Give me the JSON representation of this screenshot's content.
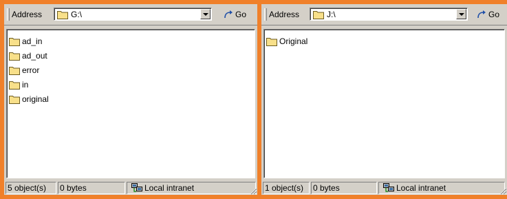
{
  "left_pane": {
    "address_label": "Address",
    "address_value": "G:\\",
    "go_label": "Go",
    "items": [
      "ad_in",
      "ad_out",
      "error",
      "in",
      "original"
    ],
    "status_objects": "5 object(s)",
    "status_bytes": "0 bytes",
    "status_zone": "Local intranet"
  },
  "right_pane": {
    "address_label": "Address",
    "address_value": "J:\\",
    "go_label": "Go",
    "items": [
      "Original"
    ],
    "status_objects": "1 object(s)",
    "status_bytes": "0 bytes",
    "status_zone": "Local intranet"
  },
  "icons": {
    "folder": "folder-icon",
    "go": "go-arrow-icon",
    "zone": "local-intranet-icon"
  },
  "colors": {
    "desktop": "#F0802A",
    "chrome": "#D4D0C8",
    "folder": "#F8E08A"
  }
}
